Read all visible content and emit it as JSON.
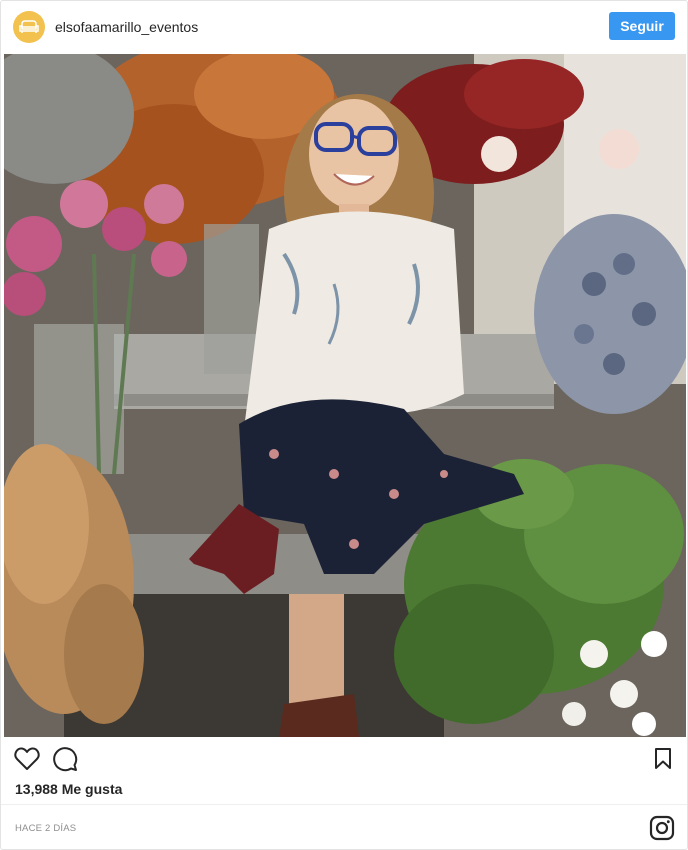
{
  "header": {
    "avatar_icon": "yellow-sofa-icon",
    "username": "elsofaamarillo_eventos",
    "follow_label": "Seguir"
  },
  "photo": {
    "description_icon": "photo"
  },
  "actions": {
    "like_icon": "heart-icon",
    "comment_icon": "comment-icon",
    "save_icon": "bookmark-icon"
  },
  "likes_text": "13,988 Me gusta",
  "timestamp": "HACE 2 DÍAS",
  "footer": {
    "logo_icon": "instagram-icon"
  },
  "colors": {
    "accent": "#3897f0",
    "avatar": "#f2c14e",
    "muted": "#8e8e8e"
  }
}
